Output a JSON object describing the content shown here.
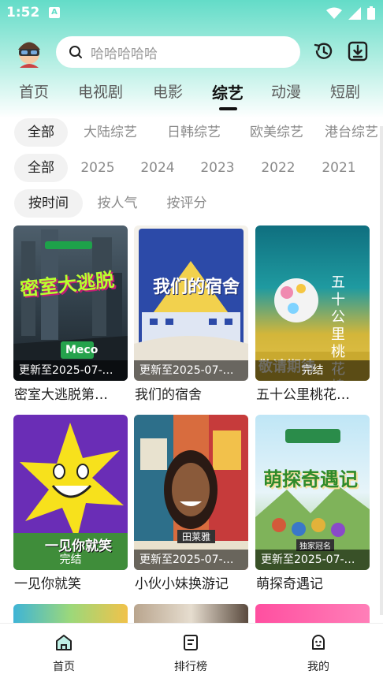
{
  "status": {
    "time": "1:52",
    "notice_icon": "A"
  },
  "search": {
    "placeholder": "哈哈哈哈哈"
  },
  "tabs": [
    {
      "label": "首页"
    },
    {
      "label": "电视剧"
    },
    {
      "label": "电影"
    },
    {
      "label": "综艺",
      "active": true
    },
    {
      "label": "动漫"
    },
    {
      "label": "短剧"
    }
  ],
  "filters": {
    "region": [
      "全部",
      "大陆综艺",
      "日韩综艺",
      "欧美综艺",
      "港台综艺"
    ],
    "year": [
      "全部",
      "2025",
      "2024",
      "2023",
      "2022",
      "2021"
    ],
    "sort": [
      "按时间",
      "按人气",
      "按评分"
    ]
  },
  "cards": [
    {
      "title": "密室大逃脱第…",
      "badge": "更新至2025-07-…",
      "poster_text": "密室大逃脱",
      "poster_sub": "Meco"
    },
    {
      "title": "我们的宿舍",
      "badge": "更新至2025-07-…",
      "poster_text": "我们的宿舍"
    },
    {
      "title": "五十公里桃花…",
      "badge": "完结",
      "poster_text": "五十公里桃花坞",
      "poster_sub": "敬请期待"
    },
    {
      "title": "一见你就笑",
      "badge": "完结",
      "poster_text": "一见你就笑"
    },
    {
      "title": "小伙小妹换游记",
      "badge": "更新至2025-07-…",
      "poster_text": "田莱雅"
    },
    {
      "title": "萌探奇遇记",
      "badge": "更新至2025-07-…",
      "poster_text": "萌探奇遇记",
      "poster_sub": "独家冠名"
    }
  ],
  "bottom_nav": [
    {
      "label": "首页",
      "icon": "home-icon"
    },
    {
      "label": "排行榜",
      "icon": "ranking-icon"
    },
    {
      "label": "我的",
      "icon": "profile-icon"
    }
  ],
  "colors": {
    "accent": "#63dcc8"
  }
}
